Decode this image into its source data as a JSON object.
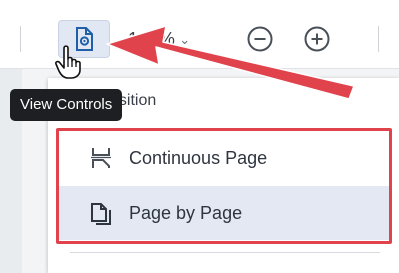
{
  "toolbar": {
    "zoom_value": "144%",
    "zoom_chevron": "⌄",
    "view_controls_icon": "page-gear-icon",
    "zoom_out_icon": "minus-circle-icon",
    "zoom_in_icon": "plus-circle-icon"
  },
  "tooltip": {
    "text": "View Controls"
  },
  "panel": {
    "header_partial": "nsition",
    "items": [
      {
        "label": "Continuous Page",
        "icon": "continuous-page-icon"
      },
      {
        "label": "Page by Page",
        "icon": "page-by-page-icon"
      }
    ]
  },
  "colors": {
    "annotation_red": "#e0434c",
    "selected_bg": "#e3e8f2",
    "tooltip_bg": "#1d1f22",
    "button_bg": "#e2e8f3",
    "icon_blue": "#1f5fa8"
  }
}
